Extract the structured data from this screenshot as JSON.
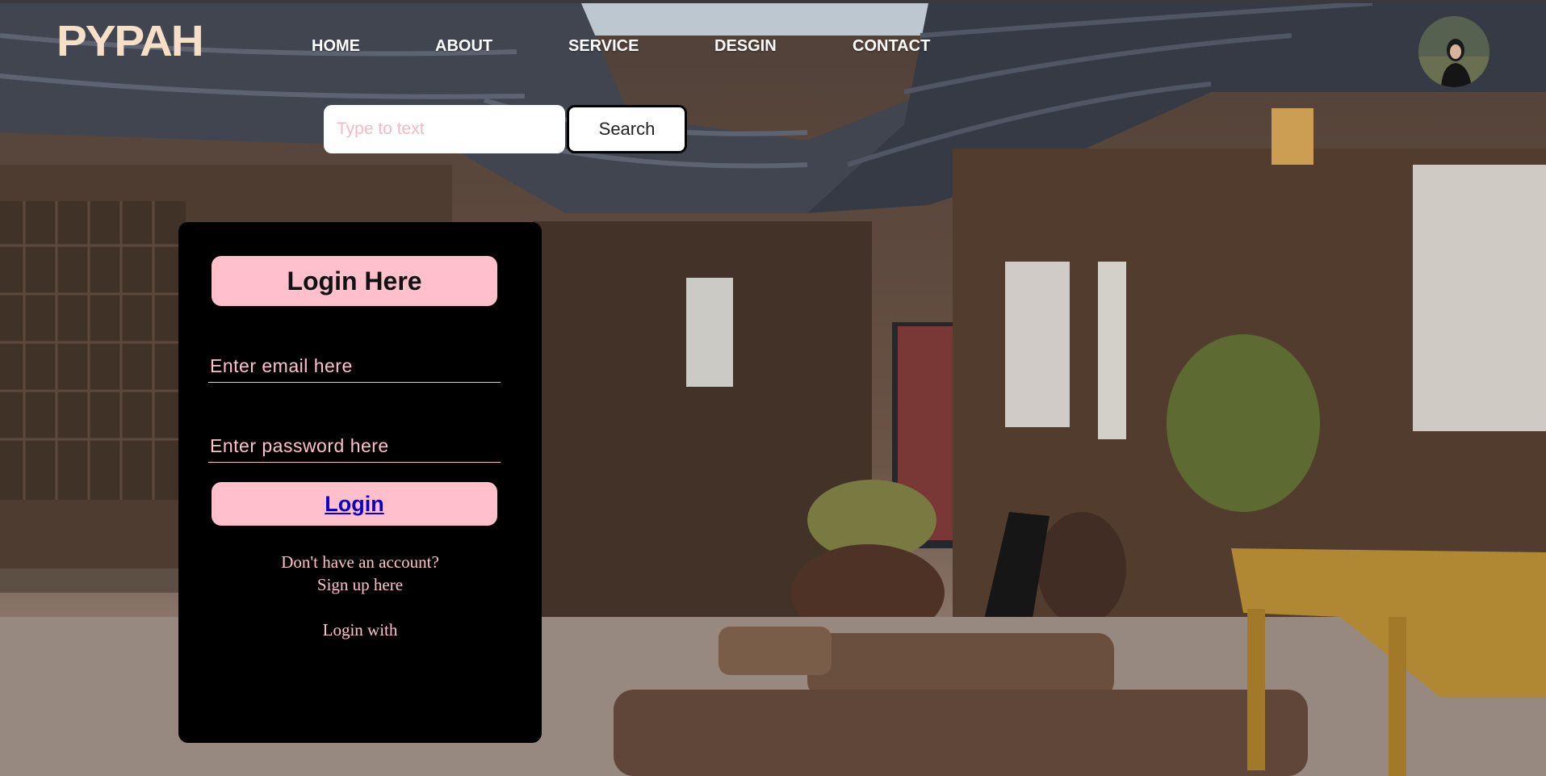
{
  "brand": {
    "logo_text": "PYPAH"
  },
  "nav": {
    "items": [
      "HOME",
      "ABOUT",
      "SERVICE",
      "DESGIN",
      "CONTACT"
    ]
  },
  "search": {
    "placeholder": "Type to text",
    "button_label": "Search"
  },
  "login": {
    "title": "Login Here",
    "email_placeholder": "Enter email here",
    "password_placeholder": "Enter password here",
    "submit_label": "Login",
    "signup_prompt": "Don't have an account?",
    "signup_link": "Sign up here",
    "login_with": "Login with"
  },
  "colors": {
    "accent_pink": "#ffc0cb",
    "card_bg": "#000000",
    "link_blue": "#0b00c8",
    "logo": "#f6dfc7"
  },
  "icons": {
    "profile": "avatar-photo"
  }
}
